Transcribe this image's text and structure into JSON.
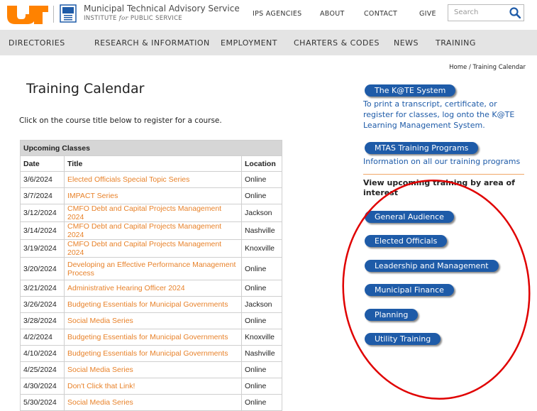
{
  "header": {
    "org_name": "Municipal Technical Advisory Service",
    "org_sub_prefix": "INSTITUTE ",
    "org_sub_for": "for",
    "org_sub_suffix": " PUBLIC SERVICE",
    "links": [
      "IPS AGENCIES",
      "ABOUT",
      "CONTACT",
      "GIVE"
    ],
    "search_placeholder": "Search",
    "brand_orange": "#ff8200"
  },
  "nav": {
    "items": [
      "DIRECTORIES",
      "RESEARCH & INFORMATION",
      "EMPLOYMENT",
      "CHARTERS & CODES",
      "NEWS",
      "TRAINING"
    ]
  },
  "breadcrumb": {
    "home": "Home",
    "sep": "/",
    "current": "Training Calendar"
  },
  "main": {
    "title": "Training Calendar",
    "intro": "Click on the course title below to register for a course.",
    "table": {
      "caption": "Upcoming Classes",
      "headers": [
        "Date",
        "Title",
        "Location"
      ],
      "rows": [
        {
          "date": "3/6/2024",
          "title": "Elected Officials Special Topic Series",
          "location": "Online"
        },
        {
          "date": "3/7/2024",
          "title": "IMPACT Series",
          "location": "Online"
        },
        {
          "date": "3/12/2024",
          "title": "CMFO Debt and Capital Projects Management 2024",
          "location": "Jackson"
        },
        {
          "date": "3/14/2024",
          "title": "CMFO Debt and Capital Projects Management 2024",
          "location": "Nashville"
        },
        {
          "date": "3/19/2024",
          "title": "CMFO Debt and Capital Projects Management 2024",
          "location": "Knoxville"
        },
        {
          "date": "3/20/2024",
          "title": "Developing an Effective Performance Management Process",
          "location": "Online"
        },
        {
          "date": "3/21/2024",
          "title": "Administrative Hearing Officer 2024",
          "location": "Online"
        },
        {
          "date": "3/26/2024",
          "title": "Budgeting Essentials for Municipal Governments",
          "location": "Jackson"
        },
        {
          "date": "3/28/2024",
          "title": "Social Media Series",
          "location": "Online"
        },
        {
          "date": "4/2/2024",
          "title": "Budgeting Essentials for Municipal Governments",
          "location": "Knoxville"
        },
        {
          "date": "4/10/2024",
          "title": "Budgeting Essentials for Municipal Governments",
          "location": "Nashville"
        },
        {
          "date": "4/25/2024",
          "title": "Social Media Series",
          "location": "Online"
        },
        {
          "date": "4/30/2024",
          "title": "Don't Click that Link!",
          "location": "Online"
        },
        {
          "date": "5/30/2024",
          "title": "Social Media Series",
          "location": "Online"
        }
      ]
    }
  },
  "sidebar": {
    "kate_button": "The K@TE System",
    "kate_text": "To print a transcript, certificate, or register for classes, log onto the K@TE Learning Management System.",
    "programs_button": "MTAS Training Programs",
    "programs_text": "Information on all our training programs",
    "area_heading": "View upcoming training by area of interest",
    "areas": [
      "General Audience",
      "Elected Officials",
      "Leadership and Management",
      "Municipal Finance",
      "Planning",
      "Utility Training"
    ],
    "accent": "#1e5ba8",
    "annotation_color": "#e00000"
  }
}
